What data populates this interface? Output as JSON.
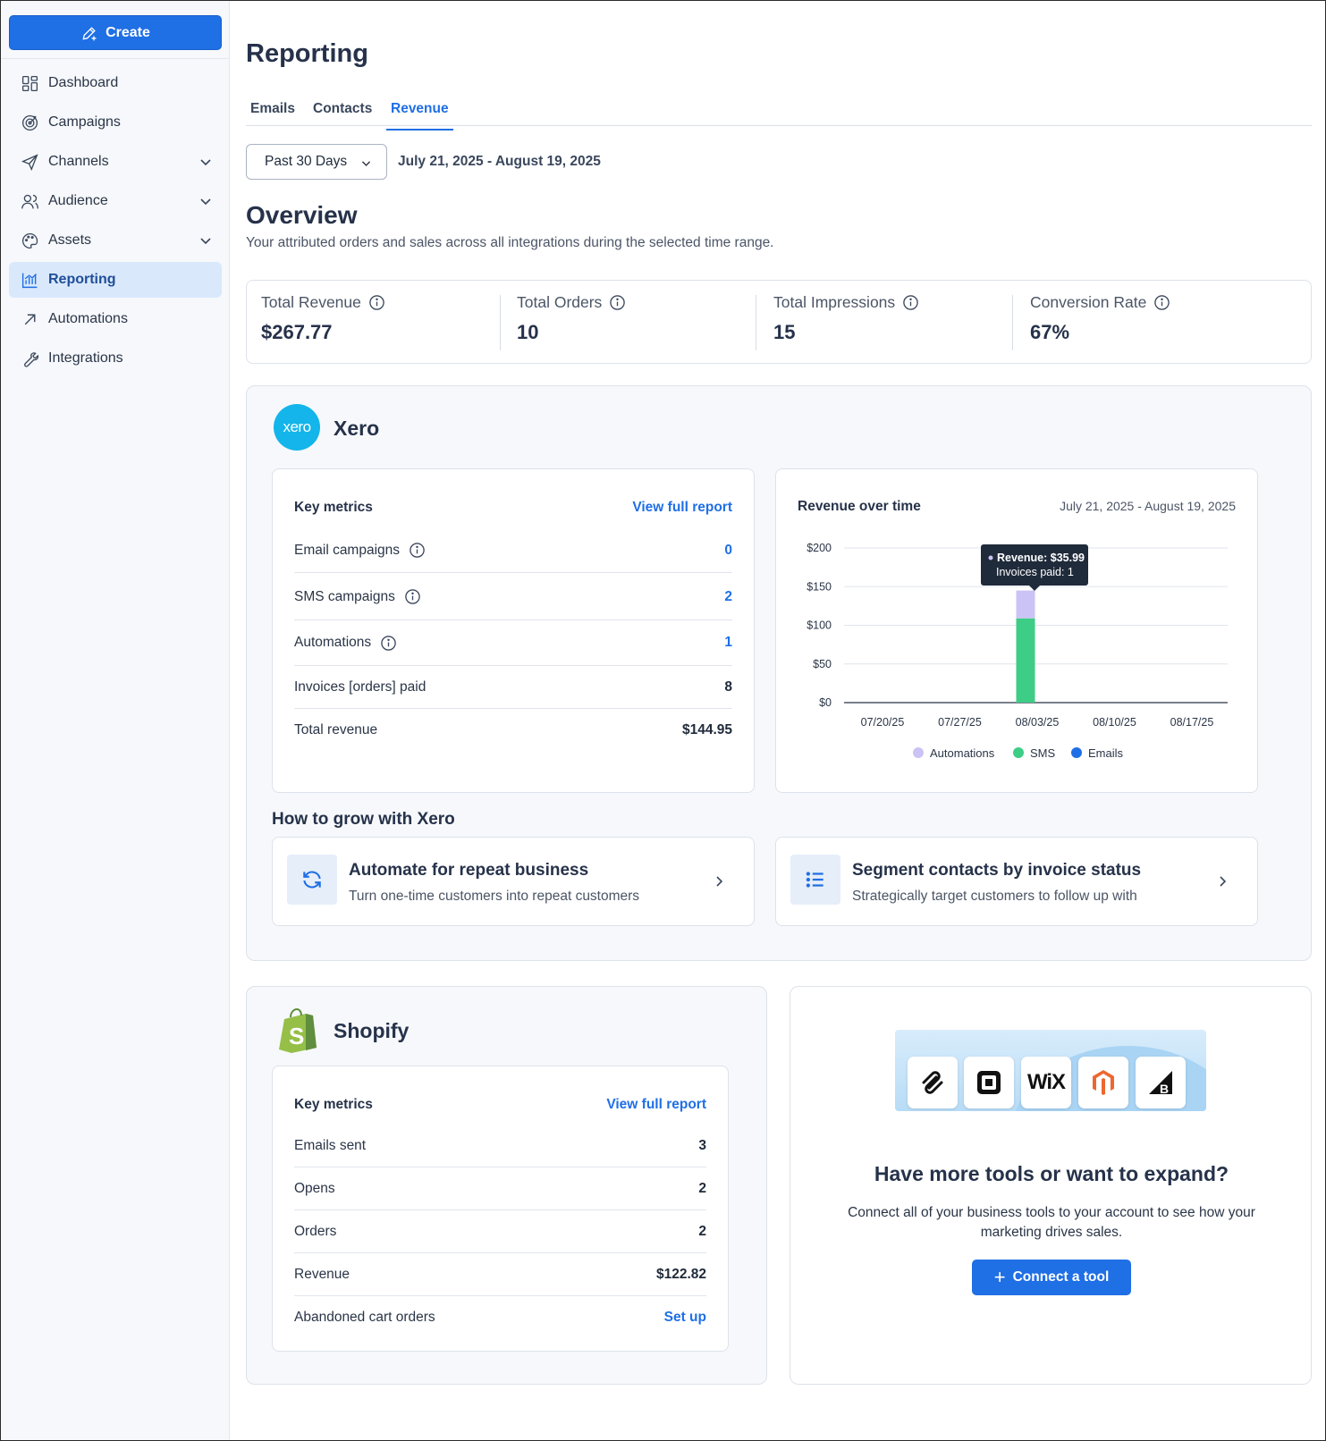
{
  "sidebar": {
    "create_label": "Create",
    "items": [
      {
        "label": "Dashboard",
        "icon": "dashboard-icon"
      },
      {
        "label": "Campaigns",
        "icon": "target-icon"
      },
      {
        "label": "Channels",
        "icon": "send-icon",
        "expandable": true
      },
      {
        "label": "Audience",
        "icon": "people-icon",
        "expandable": true
      },
      {
        "label": "Assets",
        "icon": "palette-icon",
        "expandable": true
      },
      {
        "label": "Reporting",
        "icon": "chart-icon",
        "active": true
      },
      {
        "label": "Automations",
        "icon": "arrow-up-right-icon"
      },
      {
        "label": "Integrations",
        "icon": "wrench-icon"
      }
    ]
  },
  "header": {
    "title": "Reporting",
    "tabs": [
      "Emails",
      "Contacts",
      "Revenue"
    ],
    "active_tab": "Revenue"
  },
  "filter": {
    "range_label": "Past 30 Days",
    "date_range": "July 21, 2025 - August 19, 2025"
  },
  "overview": {
    "title": "Overview",
    "subtitle": "Your attributed orders and sales across all integrations during the selected time range.",
    "stats": [
      {
        "label": "Total Revenue",
        "value": "$267.77"
      },
      {
        "label": "Total Orders",
        "value": "10"
      },
      {
        "label": "Total Impressions",
        "value": "15"
      },
      {
        "label": "Conversion Rate",
        "value": "67%"
      }
    ]
  },
  "xero": {
    "logo_text": "xero",
    "name": "Xero",
    "key_metrics": {
      "title": "Key metrics",
      "link": "View full report",
      "rows": [
        {
          "label": "Email campaigns",
          "value": "0",
          "info": true,
          "link": true
        },
        {
          "label": "SMS campaigns",
          "value": "2",
          "info": true,
          "link": true
        },
        {
          "label": "Automations",
          "value": "1",
          "info": true,
          "link": true
        },
        {
          "label": "Invoices [orders] paid",
          "value": "8"
        },
        {
          "label": "Total revenue",
          "value": "$144.95"
        }
      ]
    },
    "chart": {
      "title": "Revenue over time",
      "range": "July 21, 2025 - August 19, 2025",
      "tooltip": {
        "line1": "Revenue: $35.99",
        "line2": "Invoices paid: 1"
      }
    },
    "grow": {
      "title": "How to grow with Xero",
      "cards": [
        {
          "title": "Automate for repeat business",
          "subtitle": "Turn one-time customers into repeat customers",
          "icon": "refresh-icon"
        },
        {
          "title": "Segment contacts by invoice status",
          "subtitle": "Strategically target customers to follow up with",
          "icon": "list-icon"
        }
      ]
    }
  },
  "chart_data": {
    "type": "bar",
    "stacked": true,
    "title": "Revenue over time",
    "categories": [
      "07/20/25",
      "07/27/25",
      "08/03/25",
      "08/10/25",
      "08/17/25"
    ],
    "x_label_positions": [
      "07/20/25",
      "07/27/25",
      "08/03/25",
      "08/10/25",
      "08/17/25"
    ],
    "bar_category": "08/03/25",
    "series": [
      {
        "name": "SMS",
        "color": "#3dcd86",
        "values": [
          0,
          0,
          109,
          0,
          0
        ]
      },
      {
        "name": "Automations",
        "color": "#cbc3f5",
        "values": [
          0,
          0,
          35.99,
          0,
          0
        ]
      },
      {
        "name": "Emails",
        "color": "#1f6fe5",
        "values": [
          0,
          0,
          0,
          0,
          0
        ]
      }
    ],
    "y_ticks": [
      "$0",
      "$50",
      "$100",
      "$150",
      "$200"
    ],
    "ylim": [
      0,
      200
    ],
    "grid": true,
    "legend": "bottom"
  },
  "shopify": {
    "name": "Shopify",
    "key_metrics": {
      "title": "Key metrics",
      "link": "View full report",
      "rows": [
        {
          "label": "Emails sent",
          "value": "3"
        },
        {
          "label": "Opens",
          "value": "2"
        },
        {
          "label": "Orders",
          "value": "2"
        },
        {
          "label": "Revenue",
          "value": "$122.82"
        },
        {
          "label": "Abandoned cart orders",
          "value": "Set up",
          "link": true
        }
      ]
    }
  },
  "expand": {
    "tools": [
      "squarespace-icon",
      "square-icon",
      "wix-icon",
      "magento-icon",
      "bigcommerce-icon"
    ],
    "wix_text": "WiX",
    "title": "Have more tools or want to expand?",
    "subtitle": "Connect all of your business tools to your account to see how your marketing drives sales.",
    "button": "Connect a tool"
  },
  "colors": {
    "accent": "#1f6fe5",
    "active_nav_bg": "#d9e8fb",
    "sms": "#3dcd86",
    "automations": "#cbc3f5",
    "emails": "#1f6fe5",
    "xero": "#13b5ea",
    "shopify": "#95bf47"
  }
}
